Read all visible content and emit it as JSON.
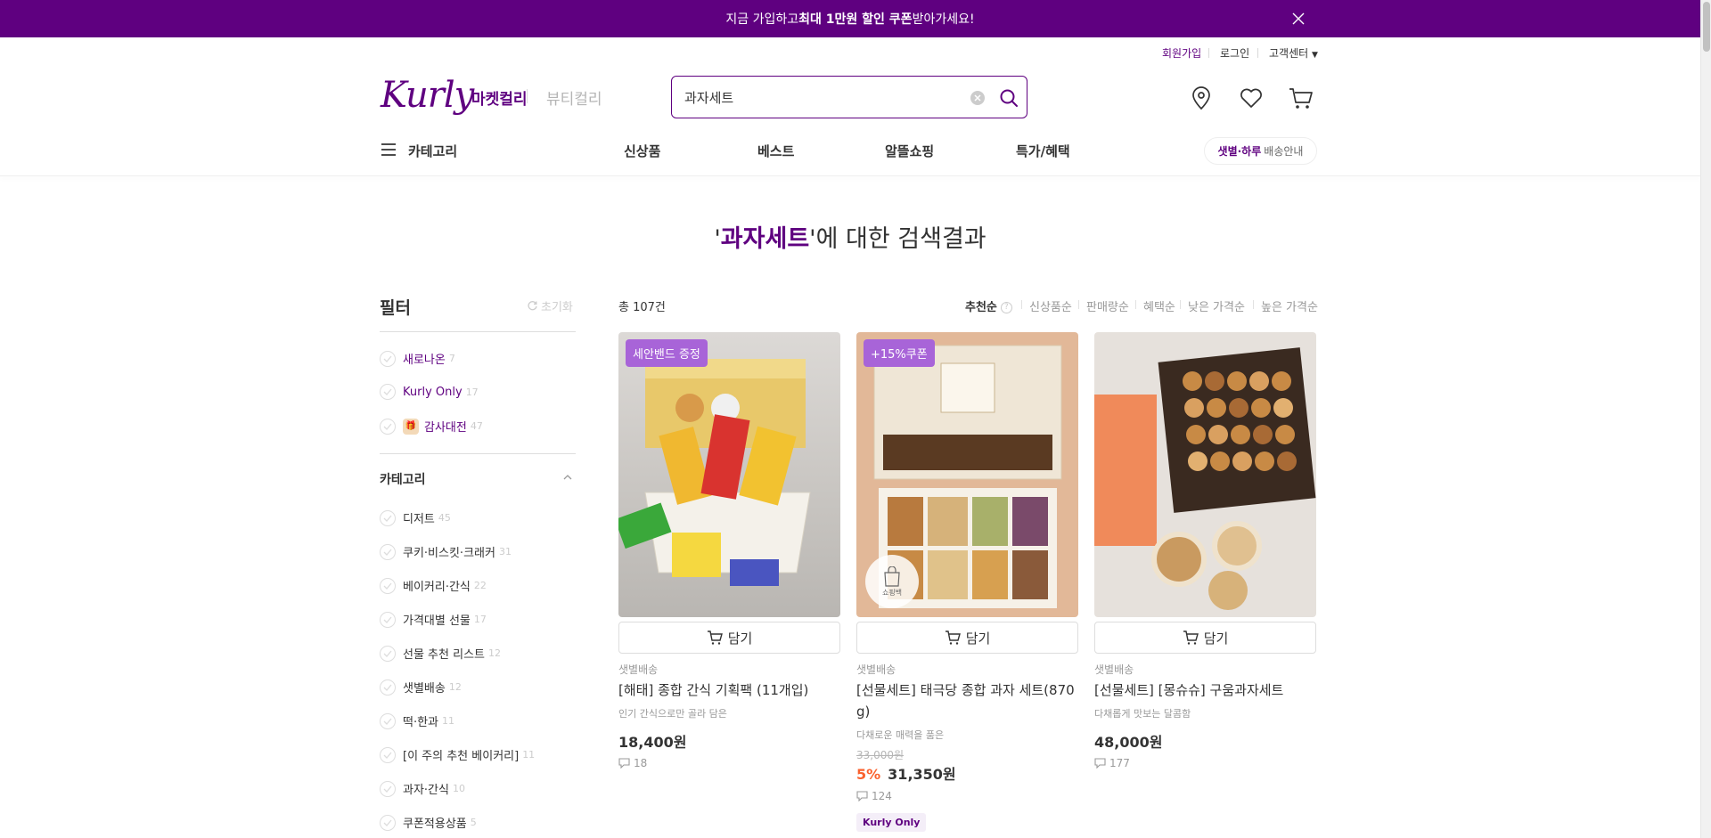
{
  "banner": {
    "pre": "지금 가입하고 ",
    "bold": "최대 1만원 할인 쿠폰",
    "post": " 받아가세요!"
  },
  "util": {
    "join": "회원가입",
    "login": "로그인",
    "cs": "고객센터"
  },
  "brand": {
    "logo": "Kurly",
    "market": "마켓컬리",
    "beauty": "뷰티컬리"
  },
  "search": {
    "value": "과자세트"
  },
  "gnb": {
    "category": "카테고리",
    "items": [
      "신상품",
      "베스트",
      "알뜰쇼핑",
      "특가/혜택"
    ],
    "delivery_bold": "샛별·하루",
    "delivery_text": "배송안내"
  },
  "result": {
    "open": "'",
    "query": "과자세트",
    "close": "'에 대한 검색결과"
  },
  "filter": {
    "title": "필터",
    "reset": "초기화",
    "quick": [
      {
        "label": "새로나온",
        "count": "7"
      },
      {
        "label": "Kurly Only",
        "count": "17"
      },
      {
        "label": "감사대전",
        "count": "47"
      }
    ],
    "category_title": "카테고리",
    "categories": [
      {
        "label": "디저트",
        "count": "45"
      },
      {
        "label": "쿠키·비스킷·크래커",
        "count": "31"
      },
      {
        "label": "베이커리·간식",
        "count": "22"
      },
      {
        "label": "가격대별 선물",
        "count": "17"
      },
      {
        "label": "선물 추천 리스트",
        "count": "12"
      },
      {
        "label": "샛별배송",
        "count": "12"
      },
      {
        "label": "떡·한과",
        "count": "11"
      },
      {
        "label": "[이 주의 추천 베이커리]",
        "count": "11"
      },
      {
        "label": "과자·간식",
        "count": "10"
      },
      {
        "label": "쿠폰적용상품",
        "count": "5"
      }
    ]
  },
  "list": {
    "total": "총 107건",
    "sorts": [
      "추천순",
      "신상품순",
      "판매량순",
      "혜택순",
      "낮은 가격순",
      "높은 가격순"
    ]
  },
  "cart_label": "담기",
  "products": [
    {
      "badge": "세안밴드 증정",
      "delivery": "샛별배송",
      "name": "[해태] 종합 간식 기획팩 (11개입)",
      "desc": "인기 간식으로만 골라 담은",
      "price": "18,400원",
      "reviews": "18"
    },
    {
      "badge": "+15%쿠폰",
      "bag": "쇼핑백",
      "delivery": "샛별배송",
      "name": "[선물세트] 태극당 종합 과자 세트(870g)",
      "desc": "다채로운 매력을 품은",
      "original": "33,000원",
      "discount": "5%",
      "price": "31,350원",
      "reviews": "124",
      "tag": "Kurly Only"
    },
    {
      "delivery": "샛별배송",
      "name": "[선물세트] [몽슈슈] 구움과자세트",
      "desc": "다채롭게 맛보는 달콤함",
      "price": "48,000원",
      "reviews": "177"
    }
  ]
}
